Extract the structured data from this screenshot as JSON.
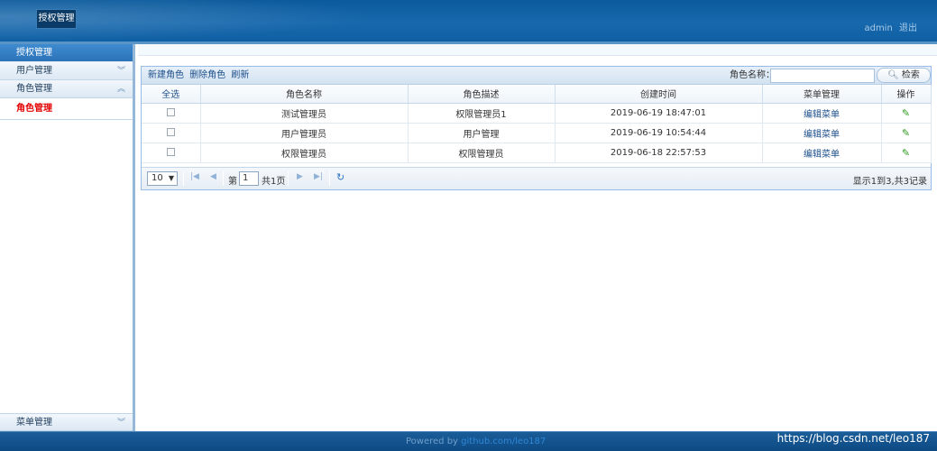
{
  "header": {
    "logo": "授权管理",
    "user": "admin",
    "logout": "退出"
  },
  "sidebar": {
    "title": "授权管理",
    "sections": [
      {
        "label": "用户管理",
        "icon": "chevron-down-icon"
      },
      {
        "label": "角色管理",
        "icon": "chevron-up-icon"
      }
    ],
    "active_item": "角色管理",
    "bottom_section": {
      "label": "菜单管理",
      "icon": "chevron-down-icon"
    }
  },
  "toolbar": {
    "new_role": "新建角色",
    "delete_role": "删除角色",
    "refresh": "刷新",
    "search_label": "角色名称：",
    "search_value": "",
    "search_button": "检索"
  },
  "table": {
    "headers": [
      "全选",
      "角色名称",
      "角色描述",
      "创建时间",
      "菜单管理",
      "操作"
    ],
    "rows": [
      {
        "name": "测试管理员",
        "desc": "权限管理员1",
        "time": "2019-06-19 18:47:01",
        "menu": "编辑菜单"
      },
      {
        "name": "用户管理员",
        "desc": "用户管理",
        "time": "2019-06-19 10:54:44",
        "menu": "编辑菜单"
      },
      {
        "name": "权限管理员",
        "desc": "权限管理员",
        "time": "2019-06-18 22:57:53",
        "menu": "编辑菜单"
      }
    ]
  },
  "pager": {
    "page_size": "10",
    "page_prefix": "第",
    "page_value": "1",
    "page_suffix": "共1页",
    "info": "显示1到3,共3记录"
  },
  "footer": {
    "powered": "Powered by",
    "link": "github.com/leo187"
  },
  "watermark": "https://blog.csdn.net/leo187",
  "colors": {
    "header": "#1768ad",
    "active_item": "#e40000",
    "link": "#1d4f8a",
    "edit_icon": "#2d9a1c"
  }
}
